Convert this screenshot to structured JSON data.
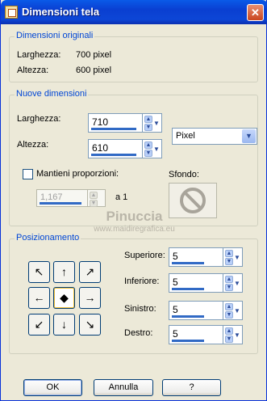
{
  "window": {
    "title": "Dimensioni tela"
  },
  "original": {
    "legend": "Dimensioni originali",
    "width_label": "Larghezza:",
    "width_value": "700 pixel",
    "height_label": "Altezza:",
    "height_value": "600 pixel"
  },
  "new_size": {
    "legend": "Nuove dimensioni",
    "width_label": "Larghezza:",
    "width_value": "710",
    "height_label": "Altezza:",
    "height_value": "610",
    "unit_value": "Pixel",
    "maintain_label": "Mantieni proporzioni:",
    "ratio_value": "1,167",
    "ratio_suffix": "a 1",
    "background_label": "Sfondo:"
  },
  "watermark": {
    "line1": "Pinuccia",
    "line2": "www.maidiregrafica.eu"
  },
  "placement": {
    "legend": "Posizionamento",
    "top_label": "Superiore:",
    "top_value": "5",
    "bottom_label": "Inferiore:",
    "bottom_value": "5",
    "left_label": "Sinistro:",
    "left_value": "5",
    "right_label": "Destro:",
    "right_value": "5",
    "anchors": [
      "↖",
      "↑",
      "↗",
      "←",
      "◆",
      "→",
      "↙",
      "↓",
      "↘"
    ]
  },
  "footer": {
    "ok": "OK",
    "cancel": "Annulla",
    "help": "?"
  },
  "colors": {
    "titlebar": "#0a4fde",
    "accent": "#316ac5",
    "legend": "#0046d5"
  }
}
